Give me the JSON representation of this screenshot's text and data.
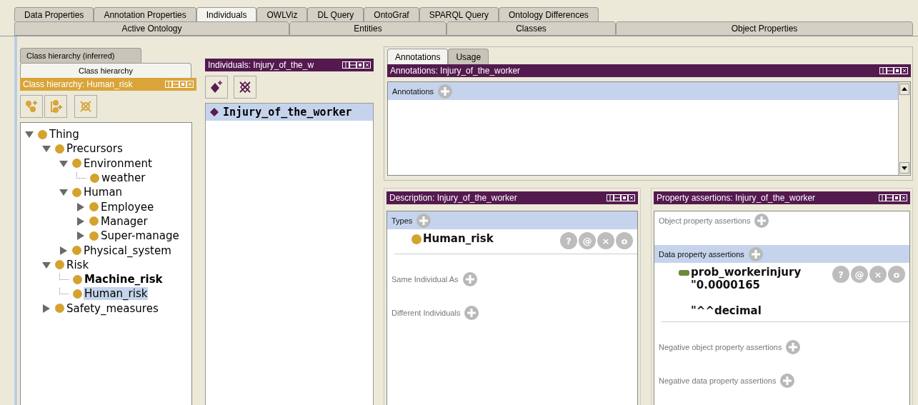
{
  "top_tabs": [
    {
      "label": "Data Properties",
      "selected": false
    },
    {
      "label": "Annotation Properties",
      "selected": false
    },
    {
      "label": "Individuals",
      "selected": true
    },
    {
      "label": "OWLViz",
      "selected": false
    },
    {
      "label": "DL Query",
      "selected": false
    },
    {
      "label": "OntoGraf",
      "selected": false
    },
    {
      "label": "SPARQL Query",
      "selected": false
    },
    {
      "label": "Ontology Differences",
      "selected": false
    }
  ],
  "workspace_tabs": [
    {
      "label": "Active Ontology"
    },
    {
      "label": "Entities"
    },
    {
      "label": "Classes"
    },
    {
      "label": "Object Properties"
    }
  ],
  "class_panel": {
    "tabs": [
      {
        "label": "Class hierarchy (inferred)",
        "selected": false
      },
      {
        "label": "Class hierarchy",
        "selected": true
      }
    ],
    "title": "Class hierarchy: Human_risk",
    "tree": [
      {
        "name": "Thing",
        "expanded": true,
        "bold": false,
        "selected": false,
        "children": [
          {
            "name": "Precursors",
            "expanded": true,
            "bold": false,
            "selected": false,
            "children": [
              {
                "name": "Environment",
                "expanded": true,
                "bold": false,
                "selected": false,
                "children": [
                  {
                    "name": "weather",
                    "bold": false,
                    "selected": false
                  }
                ]
              },
              {
                "name": "Human",
                "expanded": true,
                "bold": false,
                "selected": false,
                "children": [
                  {
                    "name": "Employee",
                    "expanded": false,
                    "bold": false,
                    "selected": false
                  },
                  {
                    "name": "Manager",
                    "expanded": false,
                    "bold": false,
                    "selected": false
                  },
                  {
                    "name": "Super-manage",
                    "expanded": false,
                    "bold": false,
                    "selected": false
                  }
                ]
              },
              {
                "name": "Physical_system",
                "expanded": false,
                "bold": false,
                "selected": false
              }
            ]
          },
          {
            "name": "Risk",
            "expanded": true,
            "bold": false,
            "selected": false,
            "children": [
              {
                "name": "Machine_risk",
                "bold": true,
                "selected": false
              },
              {
                "name": "Human_risk",
                "bold": false,
                "selected": true
              }
            ]
          },
          {
            "name": "Safety_measures",
            "expanded": false,
            "bold": false,
            "selected": false
          }
        ]
      }
    ]
  },
  "individuals_panel": {
    "title": "Individuals: Injury_of_the_w",
    "items": [
      {
        "name": "Injury_of_the_worker",
        "selected": true
      }
    ]
  },
  "annotation_panel": {
    "tabs": [
      {
        "label": "Annotations",
        "selected": true
      },
      {
        "label": "Usage",
        "selected": false
      }
    ],
    "title": "Annotations: Injury_of_the_worker",
    "section": "Annotations"
  },
  "description_panel": {
    "title": "Description: Injury_of_the_worker",
    "sections": [
      {
        "label": "Types",
        "highlighted": true,
        "entries": [
          {
            "kind": "class",
            "name": "Human_risk",
            "actions": [
              "?",
              "@",
              "×",
              "o"
            ]
          }
        ]
      },
      {
        "label": "Same Individual As",
        "highlighted": false
      },
      {
        "label": "Different Individuals",
        "highlighted": false
      }
    ]
  },
  "property_panel": {
    "title": "Property assertions: Injury_of_the_worker",
    "sections": [
      {
        "label": "Object property assertions",
        "highlighted": false
      },
      {
        "label": "Data property assertions",
        "highlighted": true,
        "entries": [
          {
            "kind": "data_property",
            "name": "prob_workerinjury",
            "value": "\"0.0000165",
            "datatype": "\"^^decimal",
            "actions": [
              "?",
              "@",
              "×",
              "o"
            ]
          }
        ]
      },
      {
        "label": "Negative object property assertions",
        "highlighted": false
      },
      {
        "label": "Negative data property assertions",
        "highlighted": false
      }
    ]
  }
}
